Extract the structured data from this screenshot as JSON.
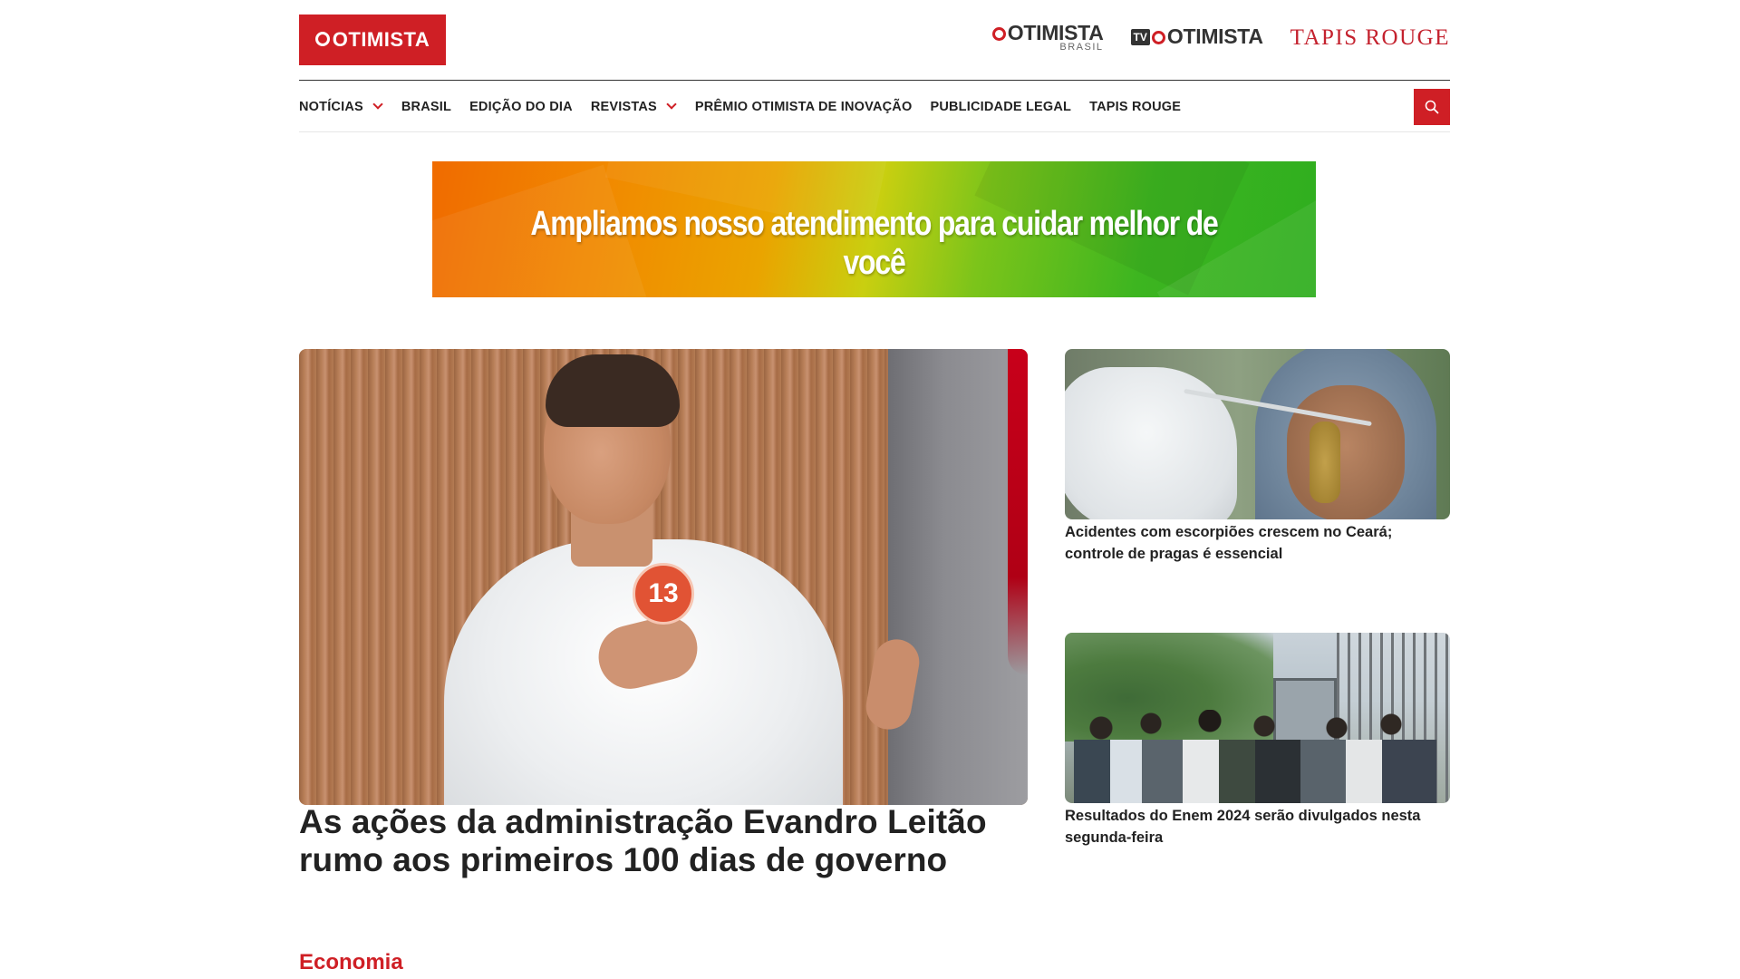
{
  "header": {
    "logo_text": "OTIMISTA",
    "brands": {
      "otimista_brasil_main": "OTIMISTA",
      "otimista_brasil_sub": "BRASIL",
      "tv_prefix": "TV",
      "tv_main": "OTIMISTA",
      "tapis_rouge": "TAPIS ROUGE"
    }
  },
  "nav": {
    "items": [
      {
        "label": "NOTÍCIAS"
      },
      {
        "label": "BRASIL"
      },
      {
        "label": "EDIÇÃO DO DIA"
      },
      {
        "label": "REVISTAS"
      },
      {
        "label": "PRÊMIO OTIMISTA DE INOVAÇÃO"
      },
      {
        "label": "PUBLICIDADE LEGAL"
      },
      {
        "label": "TAPIS ROUGE"
      }
    ],
    "search_icon": "search-icon"
  },
  "banner": {
    "text": "Ampliamos nosso atendimento para cuidar melhor de você"
  },
  "feature": {
    "badge_number": "13",
    "title": "As ações da administração Evandro Leitão rumo aos primeiros 100 dias de governo"
  },
  "side": [
    {
      "title": "Acidentes com escorpiões crescem no Ceará; controle de pragas é essencial"
    },
    {
      "title": "Resultados do Enem 2024 serão divulgados nesta segunda-feira"
    }
  ],
  "sections": {
    "economia": "Economia"
  },
  "colors": {
    "brand_red": "#cf1f25",
    "text_dark": "#222222"
  }
}
